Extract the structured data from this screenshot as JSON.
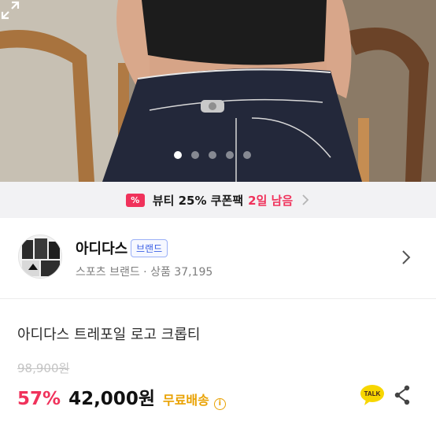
{
  "gallery": {
    "image_icon": "product-photo",
    "dot_count": 5,
    "active_index": 0,
    "expand_icon": "expand-icon"
  },
  "coupon": {
    "icon": "coupon-icon",
    "text": "뷰티 25% 쿠폰팩",
    "days": "2일 남음"
  },
  "brand": {
    "name": "아디다스",
    "badge": "브랜드",
    "subtitle": "스포츠 브랜드 · 상품 37,195"
  },
  "product": {
    "title": "아디다스 트레포일 로고 크롭티",
    "original_price": "98,900원",
    "discount": "57%",
    "price": "42,000원",
    "shipping": "무료배송",
    "talk_label": "TALK"
  },
  "colors": {
    "accent": "#f0325b",
    "shipping": "#e9a100",
    "badge": "#3a5fe5"
  }
}
